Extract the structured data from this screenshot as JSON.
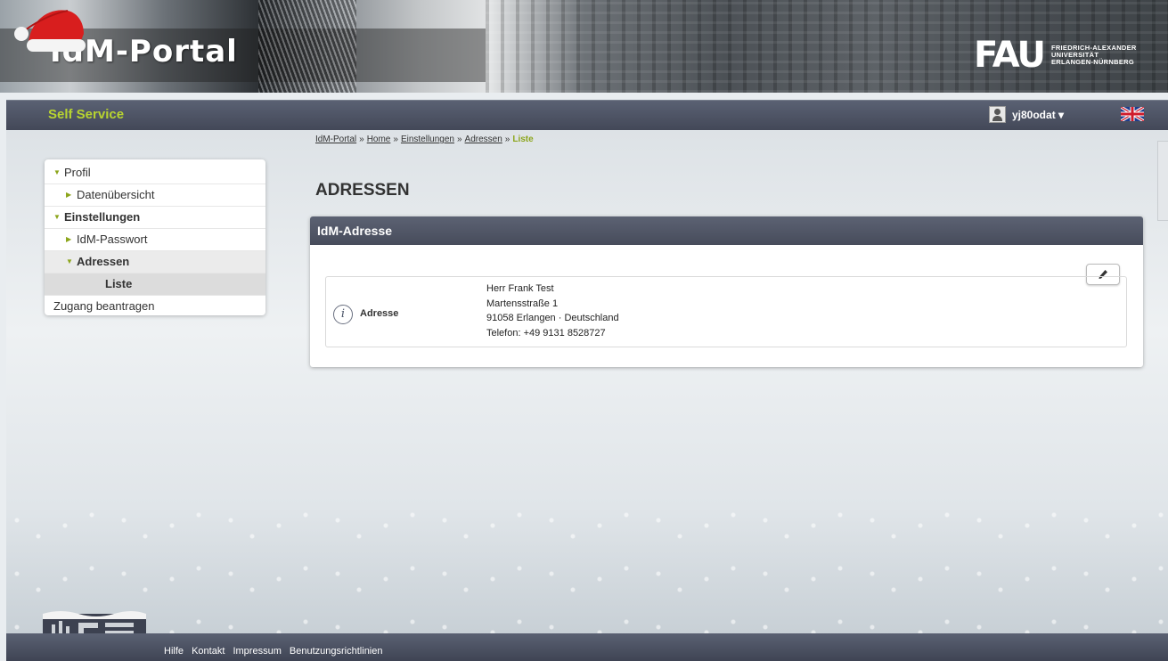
{
  "header": {
    "portal_title": "IdM-Portal",
    "university_logo_mark": "FAU",
    "university_name_lines": [
      "FRIEDRICH-ALEXANDER",
      "UNIVERSITÄT",
      "ERLANGEN-NÜRNBERG"
    ]
  },
  "navbar": {
    "section_title": "Self Service",
    "username": "yj80odat ▾",
    "language_flag_icon": "flag-uk-icon"
  },
  "breadcrumb": {
    "items": [
      "IdM-Portal",
      "Home",
      "Einstellungen",
      "Adressen"
    ],
    "separator": "»",
    "current": "Liste"
  },
  "sidebar": {
    "items": [
      {
        "label": "Profil"
      },
      {
        "label": "Datenübersicht"
      },
      {
        "label": "Einstellungen"
      },
      {
        "label": "IdM-Passwort"
      },
      {
        "label": "Adressen"
      },
      {
        "label": "Liste"
      },
      {
        "label": "Zugang beantragen"
      }
    ]
  },
  "main": {
    "page_title": "ADRESSEN",
    "panel": {
      "title": "IdM-Adresse",
      "edit_icon": "pencil-icon",
      "address": {
        "label": "Adresse",
        "info_icon": "info-icon",
        "lines": [
          "Herr Frank Test",
          "Martensstraße 1",
          "91058 Erlangen · Deutschland",
          "Telefon: +49 9131 8528727"
        ]
      }
    }
  },
  "footer": {
    "links": [
      "Hilfe",
      "Kontakt",
      "Impressum",
      "Benutzungsrichtlinien"
    ]
  }
}
